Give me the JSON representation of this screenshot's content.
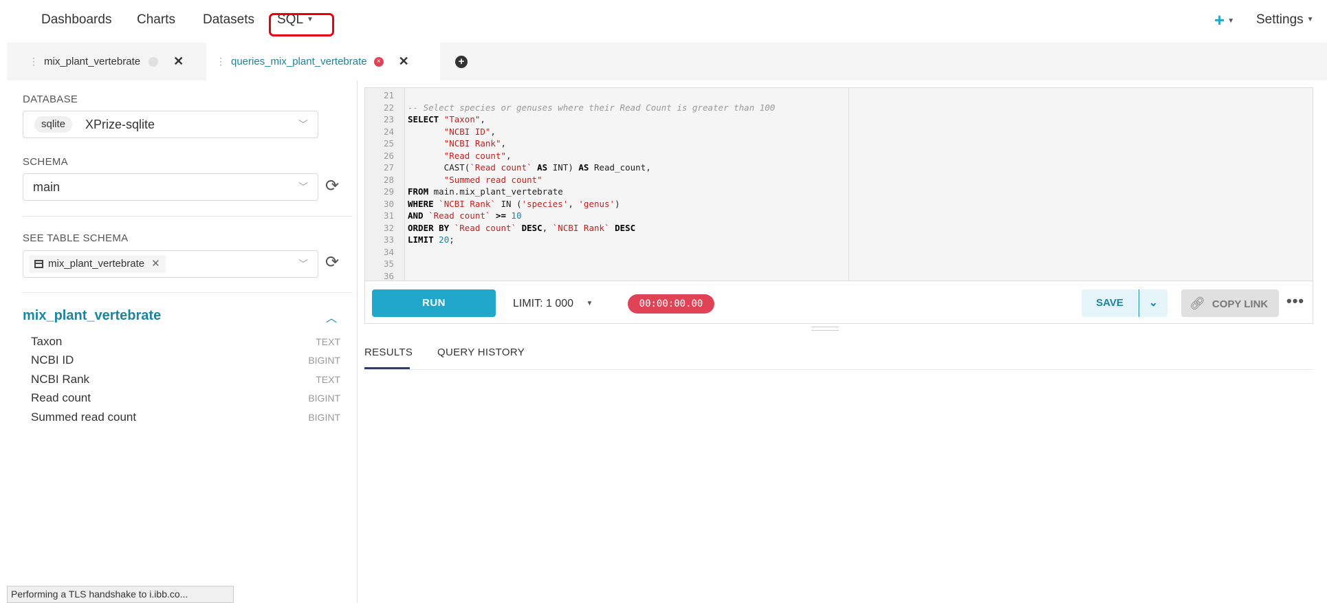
{
  "nav": {
    "items": [
      "Dashboards",
      "Charts",
      "Datasets",
      "SQL"
    ],
    "plus": "+",
    "settings": "Settings"
  },
  "tabs": [
    {
      "label": "mix_plant_vertebrate",
      "active": false
    },
    {
      "label": "queries_mix_plant_vertebrate",
      "active": true
    }
  ],
  "left": {
    "database_label": "DATABASE",
    "database_tag": "sqlite",
    "database_name": "XPrize-sqlite",
    "schema_label": "SCHEMA",
    "schema_value": "main",
    "table_schema_label": "SEE TABLE SCHEMA",
    "table_chip": "mix_plant_vertebrate",
    "table_title": "mix_plant_vertebrate",
    "columns": [
      {
        "name": "Taxon",
        "type": "TEXT"
      },
      {
        "name": "NCBI ID",
        "type": "BIGINT"
      },
      {
        "name": "NCBI Rank",
        "type": "TEXT"
      },
      {
        "name": "Read count",
        "type": "BIGINT"
      },
      {
        "name": "Summed read count",
        "type": "BIGINT"
      }
    ]
  },
  "editor": {
    "lines": [
      {
        "n": "21",
        "html": ""
      },
      {
        "n": "22",
        "html": "<span class=\"cmt\">-- Select species or genuses where their Read Count is greater than 100</span>"
      },
      {
        "n": "23",
        "html": "<span class=\"kw\">SELECT</span> <span class=\"str\">\"Taxon\"</span>,"
      },
      {
        "n": "24",
        "html": "       <span class=\"str\">\"NCBI ID\"</span>,"
      },
      {
        "n": "25",
        "html": "       <span class=\"str\">\"NCBI Rank\"</span>,"
      },
      {
        "n": "26",
        "html": "       <span class=\"str\">\"Read count\"</span>,"
      },
      {
        "n": "27",
        "html": "       CAST(<span class=\"str\">`Read count`</span> <span class=\"kw\">AS</span> INT) <span class=\"kw\">AS</span> Read_count,"
      },
      {
        "n": "28",
        "html": "       <span class=\"str\">\"Summed read count\"</span>"
      },
      {
        "n": "29",
        "html": "<span class=\"kw\">FROM</span> main.mix_plant_vertebrate"
      },
      {
        "n": "30",
        "html": "<span class=\"kw\">WHERE</span> <span class=\"str\">`NCBI Rank`</span> IN (<span class=\"str\">'species'</span>, <span class=\"str\">'genus'</span>)"
      },
      {
        "n": "31",
        "html": "<span class=\"kw\">AND</span> <span class=\"str\">`Read count`</span> <span class=\"kw\">&gt;=</span> <span class=\"num\">10</span>"
      },
      {
        "n": "32",
        "html": "<span class=\"kw\">ORDER BY</span> <span class=\"str\">`Read count`</span> <span class=\"kw\">DESC</span>, <span class=\"str\">`NCBI Rank`</span> <span class=\"kw\">DESC</span>"
      },
      {
        "n": "33",
        "html": "<span class=\"kw\">LIMIT</span> <span class=\"num\">20</span>;"
      },
      {
        "n": "34",
        "html": ""
      },
      {
        "n": "35",
        "html": ""
      },
      {
        "n": "36",
        "html": ""
      }
    ]
  },
  "runbar": {
    "run": "RUN",
    "limit_label": "LIMIT:",
    "limit_value": "1 000",
    "timer": "00:00:00.00",
    "save": "SAVE",
    "copy_link": "COPY LINK"
  },
  "results": {
    "tabs": [
      "RESULTS",
      "QUERY HISTORY"
    ]
  },
  "status_bar": "Performing a TLS handshake to i.ibb.co..."
}
